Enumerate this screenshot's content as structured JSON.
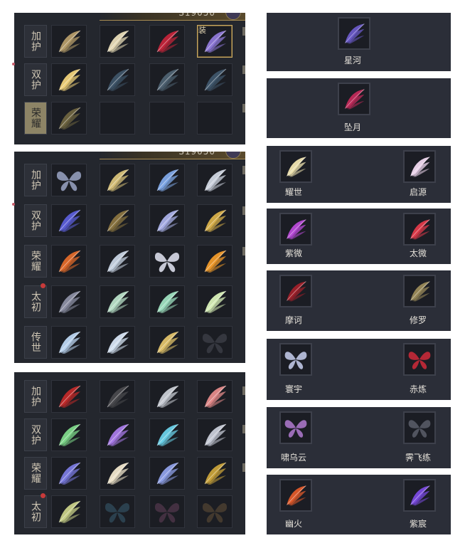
{
  "left_panels": [
    {
      "currency": "S19050",
      "categories": [
        {
          "label": "加护",
          "selected": false,
          "red_dot": false
        },
        {
          "label": "双护",
          "selected": false,
          "red_dot": false
        },
        {
          "label": "荣耀",
          "selected": true,
          "red_dot": false
        }
      ],
      "slots": [
        [
          {
            "icon": "bone-wings-icon",
            "color": "#b59c6a",
            "selected": false,
            "tag": ""
          },
          {
            "icon": "cream-wings-icon",
            "color": "#e8dcb8",
            "selected": false,
            "tag": ""
          },
          {
            "icon": "crimson-wings-icon",
            "color": "#c2243a",
            "selected": false,
            "tag": ""
          },
          {
            "icon": "violet-wings-icon",
            "color": "#8e78d8",
            "selected": true,
            "tag": "装"
          }
        ],
        [
          {
            "icon": "golden-wings-icon",
            "color": "#f0d27a",
            "selected": false,
            "tag": ""
          },
          {
            "icon": "faded-wings-icon",
            "color": "#3e5468",
            "selected": false,
            "tag": ""
          },
          {
            "icon": "faded-wings-icon",
            "color": "#4e6272",
            "selected": false,
            "tag": ""
          },
          {
            "icon": "faded-wings-icon",
            "color": "#3f566b",
            "selected": false,
            "tag": ""
          }
        ],
        [
          {
            "icon": "olive-wings-icon",
            "color": "#6e6440",
            "selected": false,
            "tag": ""
          },
          {
            "icon": "empty-slot",
            "color": "",
            "selected": false,
            "tag": ""
          },
          {
            "icon": "empty-slot",
            "color": "",
            "selected": false,
            "tag": ""
          },
          {
            "icon": "empty-slot",
            "color": "",
            "selected": false,
            "tag": ""
          }
        ]
      ]
    },
    {
      "currency": "S19050",
      "categories": [
        {
          "label": "加护",
          "selected": false,
          "red_dot": false
        },
        {
          "label": "双护",
          "selected": false,
          "red_dot": false
        },
        {
          "label": "荣耀",
          "selected": false,
          "red_dot": false
        },
        {
          "label": "太初",
          "selected": false,
          "red_dot": true
        },
        {
          "label": "传世",
          "selected": false,
          "red_dot": false
        }
      ],
      "slots": [
        [
          {
            "icon": "butterfly-wings-icon",
            "color": "#9aa4c4",
            "selected": false,
            "tag": ""
          },
          {
            "icon": "radiant-wings-icon",
            "color": "#d8c27a",
            "selected": false,
            "tag": ""
          },
          {
            "icon": "lightning-wings-icon",
            "color": "#7fa8e8",
            "selected": false,
            "tag": ""
          },
          {
            "icon": "silver-wings-icon",
            "color": "#d0d6e2",
            "selected": false,
            "tag": ""
          }
        ],
        [
          {
            "icon": "blue-wings-icon",
            "color": "#5b5ed8",
            "selected": false,
            "tag": ""
          },
          {
            "icon": "dark-gold-wings-icon",
            "color": "#8a7440",
            "selected": false,
            "tag": ""
          },
          {
            "icon": "lavender-wings-icon",
            "color": "#aab0e8",
            "selected": false,
            "tag": ""
          },
          {
            "icon": "gold-wings-icon",
            "color": "#d8b04a",
            "selected": false,
            "tag": ""
          }
        ],
        [
          {
            "icon": "fire-wings-icon",
            "color": "#e06a2a",
            "selected": false,
            "tag": ""
          },
          {
            "icon": "ice-wings-icon",
            "color": "#c8d4e4",
            "selected": false,
            "tag": ""
          },
          {
            "icon": "white-butterfly-icon",
            "color": "#e4e6f4",
            "selected": false,
            "tag": ""
          },
          {
            "icon": "flame-wings-icon",
            "color": "#f09a2a",
            "selected": false,
            "tag": ""
          }
        ],
        [
          {
            "icon": "moth-wings-icon",
            "color": "#8c8fa4",
            "selected": false,
            "tag": ""
          },
          {
            "icon": "rainbow-wings-icon",
            "color": "#b8e0c8",
            "selected": false,
            "tag": ""
          },
          {
            "icon": "jade-wings-icon",
            "color": "#9ee0c0",
            "selected": false,
            "tag": ""
          },
          {
            "icon": "pastel-wings-icon",
            "color": "#d8f0b8",
            "selected": false,
            "tag": ""
          }
        ],
        [
          {
            "icon": "frost-wings-icon",
            "color": "#bcd6f2",
            "selected": false,
            "tag": ""
          },
          {
            "icon": "frost-wings-icon",
            "color": "#d6e4f4",
            "selected": false,
            "tag": ""
          },
          {
            "icon": "gold-feather-wings-icon",
            "color": "#e0c26a",
            "selected": false,
            "tag": ""
          },
          {
            "icon": "faded-butterfly-icon",
            "color": "#3a3c44",
            "selected": false,
            "tag": ""
          }
        ]
      ]
    },
    {
      "currency": "",
      "categories": [
        {
          "label": "加护",
          "selected": false,
          "red_dot": false
        },
        {
          "label": "双护",
          "selected": false,
          "red_dot": false
        },
        {
          "label": "荣耀",
          "selected": false,
          "red_dot": false
        },
        {
          "label": "太初",
          "selected": false,
          "red_dot": true
        }
      ],
      "slots": [
        [
          {
            "icon": "red-wings-icon",
            "color": "#c02a2a",
            "selected": false,
            "tag": ""
          },
          {
            "icon": "black-wings-icon",
            "color": "#4a4a4e",
            "selected": false,
            "tag": ""
          },
          {
            "icon": "grey-wings-icon",
            "color": "#c8ccd4",
            "selected": false,
            "tag": ""
          },
          {
            "icon": "rose-wings-icon",
            "color": "#e48a8a",
            "selected": false,
            "tag": ""
          }
        ],
        [
          {
            "icon": "green-crystal-wings-icon",
            "color": "#7ed88a",
            "selected": false,
            "tag": ""
          },
          {
            "icon": "purple-crystal-wings-icon",
            "color": "#a87ae8",
            "selected": false,
            "tag": ""
          },
          {
            "icon": "cyan-crystal-wings-icon",
            "color": "#6ad0e8",
            "selected": false,
            "tag": ""
          },
          {
            "icon": "pale-wings-icon",
            "color": "#c8ccd8",
            "selected": false,
            "tag": ""
          }
        ],
        [
          {
            "icon": "indigo-wings-icon",
            "color": "#7a7ae0",
            "selected": false,
            "tag": ""
          },
          {
            "icon": "ivory-wings-icon",
            "color": "#f0e6cc",
            "selected": false,
            "tag": ""
          },
          {
            "icon": "periwinkle-wings-icon",
            "color": "#8fa0e8",
            "selected": false,
            "tag": ""
          },
          {
            "icon": "amber-wings-icon",
            "color": "#c8a23a",
            "selected": false,
            "tag": ""
          }
        ],
        [
          {
            "icon": "ethereal-wings-icon",
            "color": "#c8d088",
            "selected": false,
            "tag": ""
          },
          {
            "icon": "faded-butterfly-icon",
            "color": "#2e4656",
            "selected": false,
            "tag": ""
          },
          {
            "icon": "faded-butterfly-icon",
            "color": "#4a3446",
            "selected": false,
            "tag": ""
          },
          {
            "icon": "faded-butterfly-icon",
            "color": "#4a3e30",
            "selected": false,
            "tag": ""
          }
        ]
      ]
    }
  ],
  "right_panels": [
    {
      "items": [
        {
          "label": "星河",
          "icon": "starriver-wings-icon",
          "color": "#6a5ac8"
        }
      ]
    },
    {
      "items": [
        {
          "label": "坠月",
          "icon": "fallenmoon-wings-icon",
          "color": "#c02a5a"
        }
      ]
    },
    {
      "items": [
        {
          "label": "耀世",
          "icon": "yaoshi-wings-icon",
          "color": "#f0e4b0"
        },
        {
          "label": "启源",
          "icon": "qiyuan-wings-icon",
          "color": "#f0d8f0"
        }
      ]
    },
    {
      "items": [
        {
          "label": "紫微",
          "icon": "ziwei-wings-icon",
          "color": "#b84ad8"
        },
        {
          "label": "太微",
          "icon": "taiwei-wings-icon",
          "color": "#e03a4a"
        }
      ]
    },
    {
      "items": [
        {
          "label": "摩诃",
          "icon": "mohe-wings-icon",
          "color": "#a0202a"
        },
        {
          "label": "修罗",
          "icon": "xiuluo-wings-icon",
          "color": "#9a8a5a"
        }
      ]
    },
    {
      "items": [
        {
          "label": "寰宇",
          "icon": "huanyu-butterfly-icon",
          "color": "#c8d0f0"
        },
        {
          "label": "赤炼",
          "icon": "chilian-butterfly-icon",
          "color": "#d02a3a"
        }
      ]
    },
    {
      "items": [
        {
          "label": "啸乌云",
          "icon": "xiaowuyun-butterfly-icon",
          "color": "#b07ad0"
        },
        {
          "label": "霁飞练",
          "icon": "jifeilian-butterfly-icon",
          "color": "#5a5e6a"
        }
      ]
    },
    {
      "items": [
        {
          "label": "幽火",
          "icon": "youhuo-wings-icon",
          "color": "#e05a2a"
        },
        {
          "label": "紫宸",
          "icon": "zichen-wings-icon",
          "color": "#7a4ae0"
        }
      ]
    }
  ]
}
